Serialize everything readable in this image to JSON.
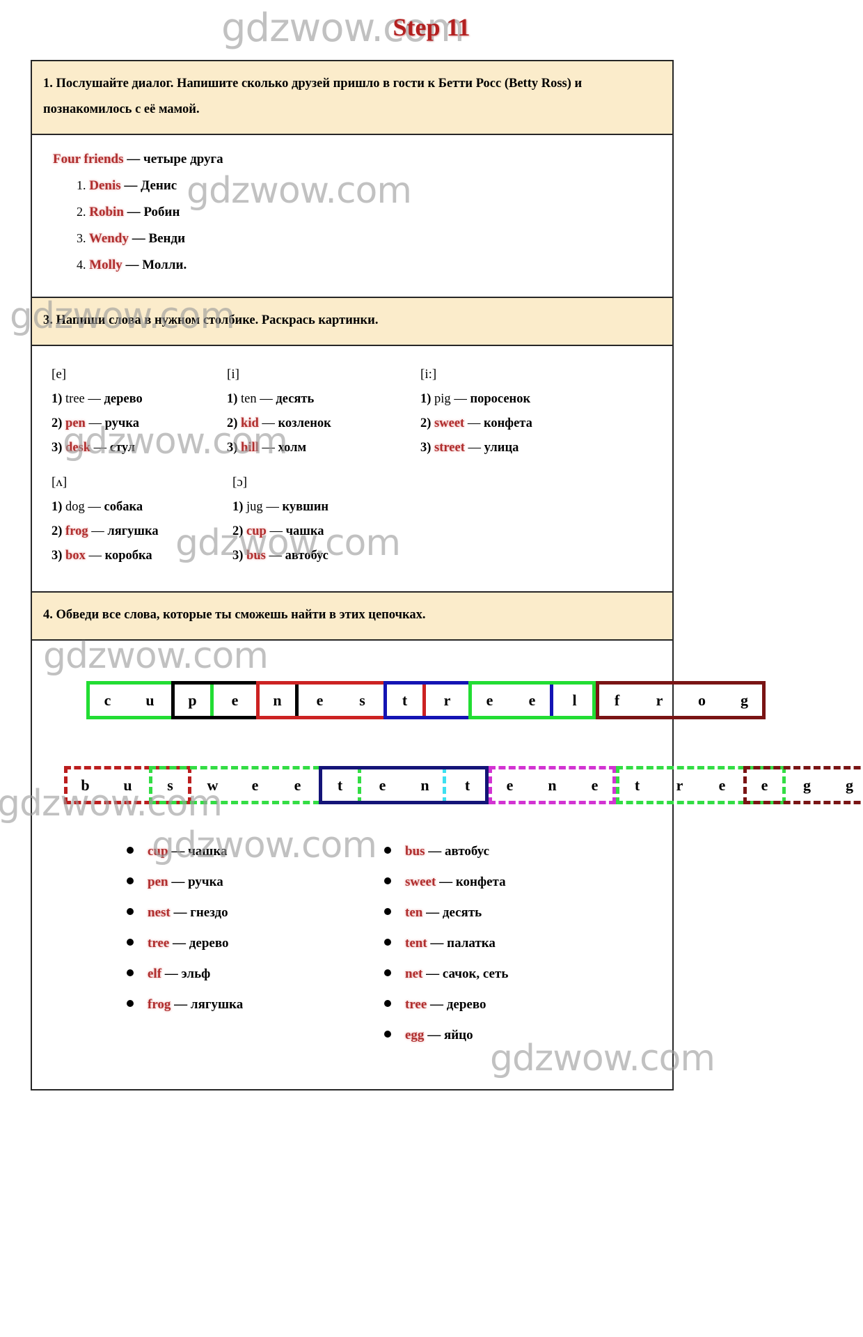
{
  "page": {
    "title": "Step 11",
    "watermark_text": "gdzwow.com"
  },
  "tasks": [
    {
      "id": "task1",
      "heading": "1.   Послушайте диалог. Напишите сколько друзей пришло в гости к Бетти Росс (Betty Ross) и познакомилось с её мамой.",
      "intro_en": "Four friends",
      "intro_dash": " — ",
      "intro_ru": "четыре друга",
      "names": [
        {
          "num": "1.",
          "en": "Denis",
          "ru": "— Денис"
        },
        {
          "num": "2.",
          "en": "Robin",
          "ru": "— Робин"
        },
        {
          "num": "3.",
          "en": "Wendy",
          "ru": "— Венди"
        },
        {
          "num": "4.",
          "en": "Molly",
          "ru": "— Молли."
        }
      ]
    },
    {
      "id": "task3",
      "heading": "3. Напиши слова в нужном столбике. Раскрась картинки.",
      "columns_row1": [
        {
          "symbol": "[e]",
          "words": [
            {
              "idx": "1)",
              "en": "tree",
              "red": false,
              "dash": "—",
              "ru": "дерево"
            },
            {
              "idx": "2)",
              "en": "pen",
              "red": true,
              "dash": "—",
              "ru": "ручка"
            },
            {
              "idx": "3)",
              "en": "desk",
              "red": true,
              "dash": "—",
              "ru": "стул"
            }
          ]
        },
        {
          "symbol": "[i]",
          "words": [
            {
              "idx": "1)",
              "en": "ten",
              "red": false,
              "dash": "—",
              "ru": "десять"
            },
            {
              "idx": "2)",
              "en": "kid",
              "red": true,
              "dash": "—",
              "ru": "козленок"
            },
            {
              "idx": "3)",
              "en": "hill",
              "red": true,
              "dash": "—",
              "ru": "холм"
            }
          ]
        },
        {
          "symbol": "[i:]",
          "words": [
            {
              "idx": "1)",
              "en": "pig",
              "red": false,
              "dash": "—",
              "ru": "поросенок"
            },
            {
              "idx": "2)",
              "en": "sweet",
              "red": true,
              "dash": "—",
              "ru": "конфета"
            },
            {
              "idx": "3)",
              "en": "street",
              "red": true,
              "dash": "—",
              "ru": "улица"
            }
          ]
        }
      ],
      "columns_row2": [
        {
          "symbol": "[ʌ]",
          "words": [
            {
              "idx": "1)",
              "en": "dog",
              "red": false,
              "dash": "—",
              "ru": "собака"
            },
            {
              "idx": "2)",
              "en": "frog",
              "red": true,
              "dash": "—",
              "ru": "лягушка"
            },
            {
              "idx": "3)",
              "en": "box",
              "red": true,
              "dash": "—",
              "ru": "коробка"
            }
          ]
        },
        {
          "symbol": "[ɔ]",
          "words": [
            {
              "idx": "1)",
              "en": "jug",
              "red": false,
              "dash": "—",
              "ru": "кувшин"
            },
            {
              "idx": "2)",
              "en": "cup",
              "red": true,
              "dash": "—",
              "ru": "чашка"
            },
            {
              "idx": "3)",
              "en": "bus",
              "red": true,
              "dash": "—",
              "ru": "автобус"
            }
          ]
        }
      ]
    },
    {
      "id": "task4",
      "heading": "4. Обведи все слова, которые ты сможешь найти в этих цепочках.",
      "chain1": {
        "letters": [
          "c",
          "u",
          "p",
          "e",
          "n",
          "e",
          "s",
          "t",
          "r",
          "e",
          "e",
          "l",
          "f",
          "r",
          "o",
          "g"
        ],
        "highlights": [
          {
            "word": "cup",
            "start": 0,
            "length": 3,
            "color": "#22dd33",
            "style": "solid"
          },
          {
            "word": "pen",
            "start": 2,
            "length": 3,
            "color": "#000000",
            "style": "solid"
          },
          {
            "word": "nest",
            "start": 4,
            "length": 4,
            "color": "#cc2222",
            "style": "solid"
          },
          {
            "word": "tree",
            "start": 7,
            "length": 4,
            "color": "#1414b4",
            "style": "solid"
          },
          {
            "word": "elf",
            "start": 9,
            "length": 3,
            "color": "#22dd33",
            "style": "solid"
          },
          {
            "word": "frog",
            "start": 12,
            "length": 4,
            "color": "#7a1414",
            "style": "solid"
          }
        ]
      },
      "chain2": {
        "letters": [
          "b",
          "u",
          "s",
          "w",
          "e",
          "e",
          "t",
          "e",
          "n",
          "t",
          "e",
          "n",
          "e",
          "t",
          "r",
          "e",
          "e",
          "g",
          "g"
        ],
        "highlights": [
          {
            "word": "bus",
            "start": 0,
            "length": 3,
            "color": "#bb1e1e",
            "style": "dashed"
          },
          {
            "word": "sweet",
            "start": 2,
            "length": 5,
            "color": "#33dd44",
            "style": "dashed"
          },
          {
            "word": "ten",
            "start": 6,
            "length": 3,
            "color": "#3de0f0",
            "style": "dashed"
          },
          {
            "word": "tent",
            "start": 6,
            "length": 4,
            "color": "#141478",
            "style": "solid"
          },
          {
            "word": "net",
            "start": 10,
            "length": 3,
            "color": "#d233d2",
            "style": "dashed"
          },
          {
            "word": "tree",
            "start": 13,
            "length": 4,
            "color": "#33dd44",
            "style": "dashed"
          },
          {
            "word": "egg",
            "start": 16,
            "length": 3,
            "color": "#7a1414",
            "style": "dashed"
          }
        ]
      },
      "answers_left": [
        {
          "en": "cup",
          "dash": "—",
          "ru": "чашка"
        },
        {
          "en": "pen",
          "dash": "—",
          "ru": "ручка"
        },
        {
          "en": "nest",
          "dash": "—",
          "ru": "гнездо"
        },
        {
          "en": "tree",
          "dash": "—",
          "ru": "дерево"
        },
        {
          "en": "elf",
          "dash": "—",
          "ru": "эльф"
        },
        {
          "en": "frog",
          "dash": "—",
          "ru": "лягушка"
        }
      ],
      "answers_right": [
        {
          "en": "bus",
          "dash": "—",
          "ru": "автобус"
        },
        {
          "en": "sweet",
          "dash": "—",
          "ru": "конфета"
        },
        {
          "en": "ten",
          "dash": "—",
          "ru": "десять"
        },
        {
          "en": "tent",
          "dash": "—",
          "ru": "палатка"
        },
        {
          "en": "net",
          "dash": "—",
          "ru": "сачок, сеть"
        },
        {
          "en": "tree",
          "dash": "—",
          "ru": "дерево"
        },
        {
          "en": "egg",
          "dash": "—",
          "ru": "яйцо"
        }
      ]
    }
  ],
  "colors": {
    "heading_bg": "#fbeccb",
    "accent_red": "#b02e2e",
    "title_red": "#b32020",
    "border": "#262626"
  }
}
